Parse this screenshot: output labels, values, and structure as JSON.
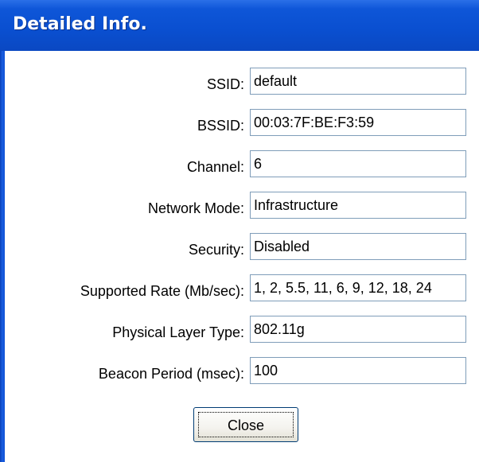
{
  "dialog": {
    "title": "Detailed Info."
  },
  "fields": [
    {
      "label": "SSID:",
      "value": "default"
    },
    {
      "label": "BSSID:",
      "value": "00:03:7F:BE:F3:59"
    },
    {
      "label": "Channel:",
      "value": "6"
    },
    {
      "label": "Network Mode:",
      "value": "Infrastructure"
    },
    {
      "label": "Security:",
      "value": "Disabled"
    },
    {
      "label": "Supported Rate (Mb/sec):",
      "value": "1, 2, 5.5, 11, 6, 9, 12, 18, 24"
    },
    {
      "label": "Physical Layer Type:",
      "value": "802.11g"
    },
    {
      "label": "Beacon Period (msec):",
      "value": "100"
    }
  ],
  "buttons": {
    "close_label": "Close"
  },
  "colors": {
    "titlebar": "#0a4fd0",
    "field_border": "#7f9db9",
    "button_border": "#003c74"
  }
}
